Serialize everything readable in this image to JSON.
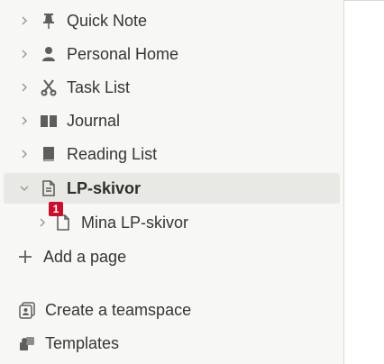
{
  "sidebar": {
    "items": [
      {
        "label": "Quick Note",
        "icon": "pin-icon"
      },
      {
        "label": "Personal Home",
        "icon": "person-icon"
      },
      {
        "label": "Task List",
        "icon": "scissors-icon"
      },
      {
        "label": "Journal",
        "icon": "book-open-icon"
      },
      {
        "label": "Reading List",
        "icon": "book-icon"
      },
      {
        "label": "LP-skivor",
        "icon": "page-icon"
      },
      {
        "label": "Mina LP-skivor",
        "icon": "page-icon"
      }
    ],
    "badge": "1",
    "add_page_label": "Add a page",
    "create_teamspace_label": "Create a teamspace",
    "templates_label": "Templates"
  },
  "colors": {
    "sidebar_bg": "#f7f7f5",
    "active_bg": "#e8e8e5",
    "text": "#37352f",
    "badge": "#c8102e"
  }
}
